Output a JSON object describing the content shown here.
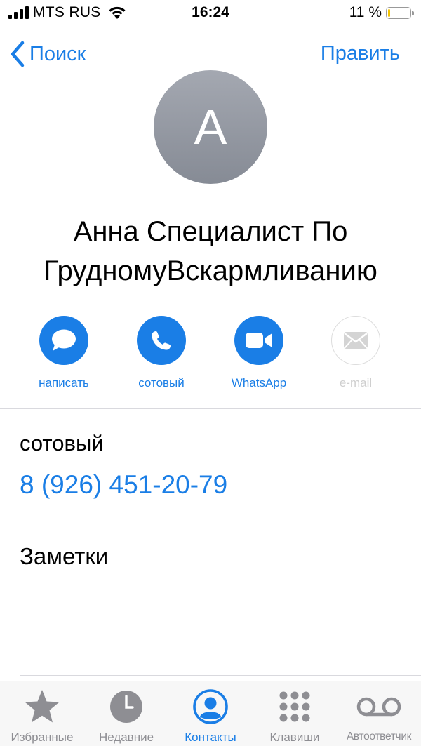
{
  "status_bar": {
    "carrier": "MTS RUS",
    "time": "16:24",
    "battery": "11 %",
    "battery_level": 0.11,
    "battery_color": "#f4c400"
  },
  "nav": {
    "back_label": "Поиск",
    "edit_label": "Править"
  },
  "contact": {
    "avatar_initial": "А",
    "name": "Анна Специалист По ГрудномуВскармливанию"
  },
  "actions": [
    {
      "label": "написать",
      "icon": "message-icon",
      "enabled": true
    },
    {
      "label": "сотовый",
      "icon": "phone-icon",
      "enabled": true
    },
    {
      "label": "WhatsApp",
      "icon": "video-icon",
      "enabled": true
    },
    {
      "label": "e-mail",
      "icon": "mail-icon",
      "enabled": false
    }
  ],
  "phone_field": {
    "label": "сотовый",
    "value": "8 (926) 451-20-79"
  },
  "notes": {
    "label": "Заметки"
  },
  "tab_bar": {
    "tabs": [
      {
        "label": "Избранные",
        "icon": "star-icon",
        "active": false
      },
      {
        "label": "Недавние",
        "icon": "clock-icon",
        "active": false
      },
      {
        "label": "Контакты",
        "icon": "person-icon",
        "active": true
      },
      {
        "label": "Клавиши",
        "icon": "keypad-icon",
        "active": false
      },
      {
        "label": "Автоответчик",
        "icon": "voicemail-icon",
        "active": false
      }
    ]
  },
  "colors": {
    "accent": "#1a7ee6",
    "inactive": "#8e8e93"
  }
}
